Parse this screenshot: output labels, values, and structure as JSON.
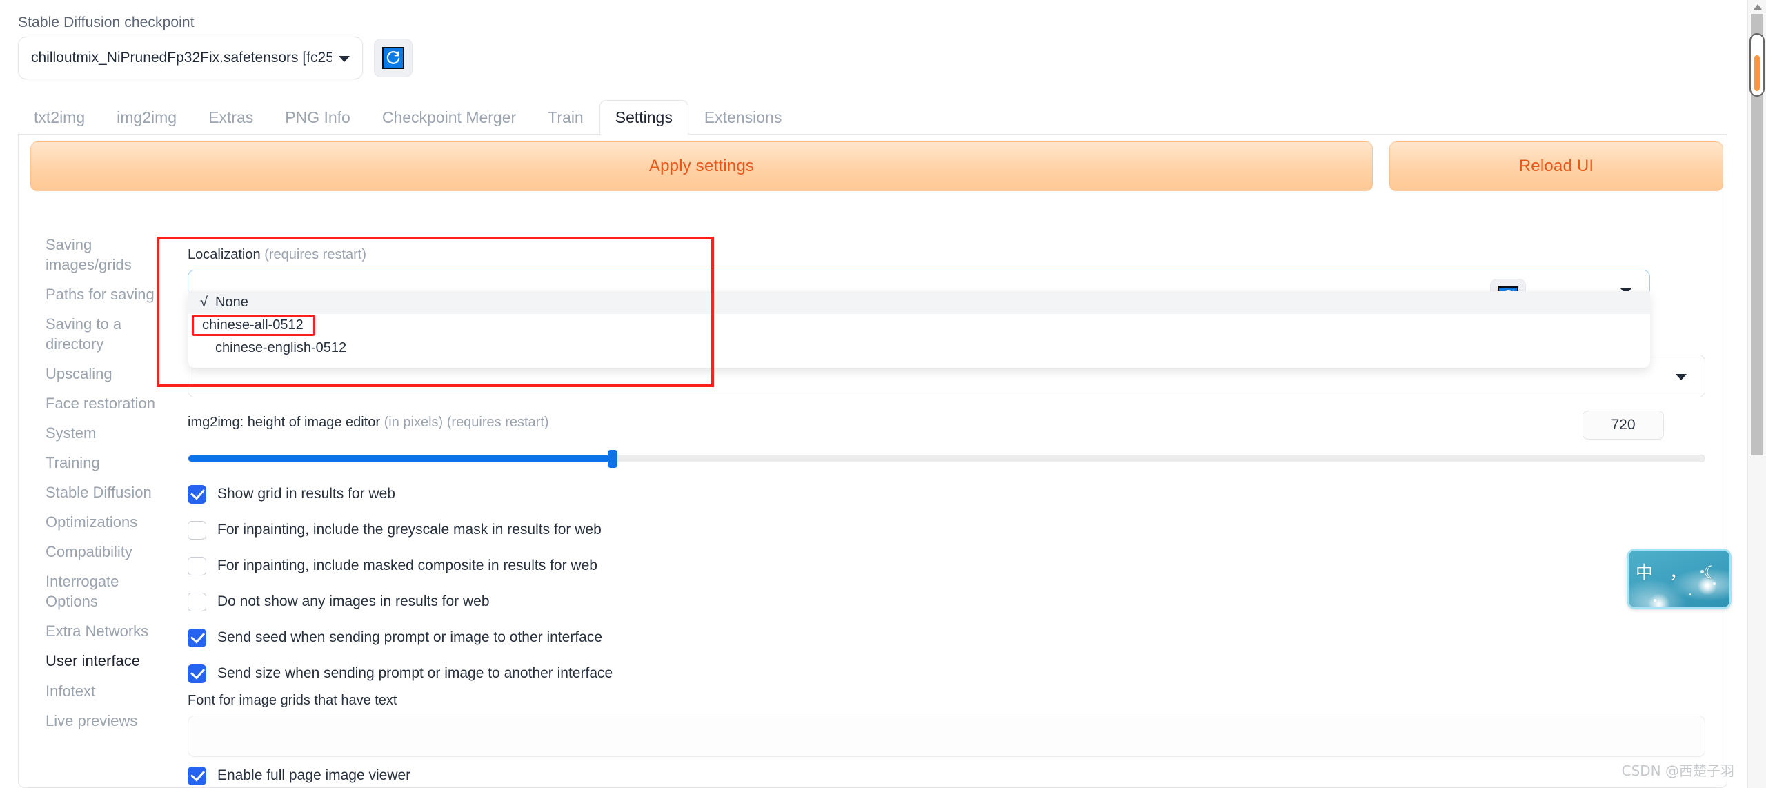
{
  "checkpoint": {
    "label": "Stable Diffusion checkpoint",
    "value": "chilloutmix_NiPrunedFp32Fix.safetensors [fc25",
    "refresh_icon": "refresh-icon"
  },
  "tabs": [
    {
      "label": "txt2img",
      "active": false
    },
    {
      "label": "img2img",
      "active": false
    },
    {
      "label": "Extras",
      "active": false
    },
    {
      "label": "PNG Info",
      "active": false
    },
    {
      "label": "Checkpoint Merger",
      "active": false
    },
    {
      "label": "Train",
      "active": false
    },
    {
      "label": "Settings",
      "active": true
    },
    {
      "label": "Extensions",
      "active": false
    }
  ],
  "toolbar": {
    "apply_label": "Apply settings",
    "reload_label": "Reload UI",
    "accent": "#e8561a"
  },
  "sidebar": {
    "items": [
      {
        "label": "Saving\nimages/grids",
        "active": false
      },
      {
        "label": "Paths for saving",
        "active": false
      },
      {
        "label": "Saving to a\ndirectory",
        "active": false
      },
      {
        "label": "Upscaling",
        "active": false
      },
      {
        "label": "Face restoration",
        "active": false
      },
      {
        "label": "System",
        "active": false
      },
      {
        "label": "Training",
        "active": false
      },
      {
        "label": "Stable Diffusion",
        "active": false
      },
      {
        "label": "Optimizations",
        "active": false
      },
      {
        "label": "Compatibility",
        "active": false
      },
      {
        "label": "Interrogate\nOptions",
        "active": false
      },
      {
        "label": "Extra Networks",
        "active": false
      },
      {
        "label": "User interface",
        "active": true
      },
      {
        "label": "Infotext",
        "active": false
      },
      {
        "label": "Live previews",
        "active": false
      }
    ]
  },
  "localization": {
    "label": "Localization",
    "hint": "(requires restart)",
    "value": "",
    "options": [
      {
        "label": "None",
        "checked": true,
        "highlighted": false
      },
      {
        "label": "chinese-all-0512",
        "checked": false,
        "highlighted": true
      },
      {
        "label": "chinese-english-0512",
        "checked": false,
        "highlighted": false
      }
    ],
    "check_glyph": "√",
    "refresh_icon": "refresh-icon",
    "highlight_color": "#ff1f1f"
  },
  "slider": {
    "label": "img2img: height of image editor",
    "hint": "(in pixels) (requires restart)",
    "value": "720",
    "fill_percent": 28,
    "fill_color": "#0b72e8"
  },
  "checkboxes": [
    {
      "label": "Show grid in results for web",
      "checked": true
    },
    {
      "label": "For inpainting, include the greyscale mask in results for web",
      "checked": false
    },
    {
      "label": "For inpainting, include masked composite in results for web",
      "checked": false
    },
    {
      "label": "Do not show any images in results for web",
      "checked": false
    },
    {
      "label": "Send seed when sending prompt or image to other interface",
      "checked": true
    },
    {
      "label": "Send size when sending prompt or image to another interface",
      "checked": true
    }
  ],
  "font_field": {
    "label": "Font for image grids that have text",
    "value": ""
  },
  "final_checkbox": {
    "label": "Enable full page image viewer",
    "checked": true
  },
  "floating_badge": {
    "text": "中 ， ☾"
  },
  "watermark": {
    "text": "CSDN @西楚子羽"
  }
}
